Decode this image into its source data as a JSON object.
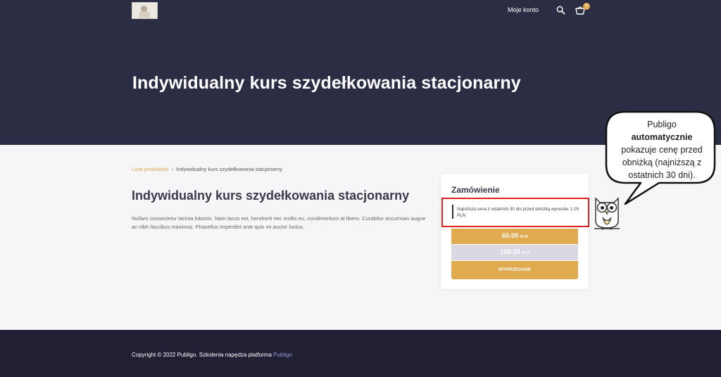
{
  "header": {
    "account_label": "Moje konto",
    "cart_count": "0",
    "hero_title": "Indywidualny kurs szydełkowania stacjonarny",
    "icons": [
      "search-icon",
      "cart-icon"
    ]
  },
  "breadcrumb": {
    "link": "Lista produktów",
    "separator": "›",
    "current": "Indywidualny kurs szydełkowania stacjonarny"
  },
  "product": {
    "title": "Indywidualny kurs szydełkowania stacjonarny",
    "description": "Nullam consectetur lacinia lobortis. Nam lacus est, hendrerit nec mollis eu, condimentum at libero. Curabitur accumsan augue ac nibh faucibus maximus. Phasellus imperdiet ante quis mi auctor luctus."
  },
  "order": {
    "heading": "Zamówienie",
    "lowest_price_note": "Najniższa cena z ostatnich 30 dni przed obniżką wynosiła: 1.00 PLN",
    "price_now": "60.00",
    "price_old": "100.00",
    "currency": "PLN",
    "sold_out_label": "WYPRZEDANE"
  },
  "callout": {
    "line1": "Publigo",
    "bold": "automatycznie",
    "line3": "pokazuje cenę przed obniżką (najniższą z ostatnich 30 dni)."
  },
  "footer": {
    "copyright": "Copyright © 2022 Publigo. Szkolenia napędza platforma ",
    "brand_link": "Publigo"
  },
  "colors": {
    "hero_bg": "#2b2d45",
    "accent": "#e0aa4e",
    "highlight_border": "#e02020",
    "footer_bg": "#211f33"
  }
}
